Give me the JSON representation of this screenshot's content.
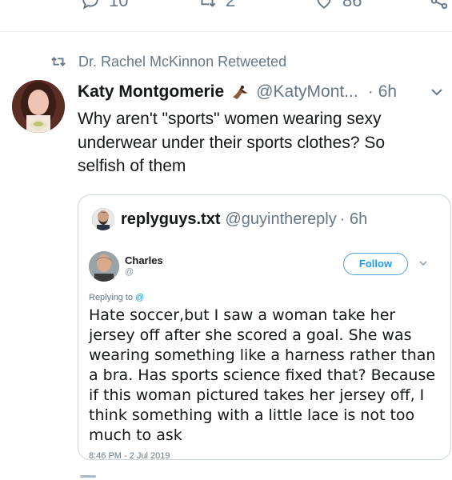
{
  "top_actions": {
    "reply_count": "10",
    "retweet_count": "2",
    "like_count": "86"
  },
  "retweet_header": {
    "text": "Dr. Rachel McKinnon Retweeted"
  },
  "tweet": {
    "display_name": "Katy Montgomerie",
    "handle": "@KatyMont...",
    "separator": "·",
    "time": "6h",
    "text": "Why aren't \"sports\" women wearing sexy underwear under their sports clothes? So selfish of them"
  },
  "quoted": {
    "display_name": "replyguys.txt",
    "handle": "@guyinthereply",
    "time_sep": "· 6h",
    "screenshot": {
      "name": "Charles",
      "at": "@",
      "follow_label": "Follow",
      "replying_label": "Replying to",
      "replying_at": "@",
      "body": "Hate soccer,but I saw a woman take her jersey off after she scored a goal. She was wearing something like a harness rather than a bra. Has sports science fixed that? Because if this woman pictured takes her jersey off, I think something with a little lace is not too much to ask",
      "date": "8:46 PM - 2 Jul 2019"
    }
  },
  "icons": {
    "reply": "reply-icon",
    "retweet": "retweet-icon",
    "like": "heart-icon",
    "share": "share-icon",
    "more": "chevron-down-icon"
  },
  "colors": {
    "secondary_text": "#657786",
    "accent": "#1d9bf0",
    "border": "#ccd6dd"
  }
}
